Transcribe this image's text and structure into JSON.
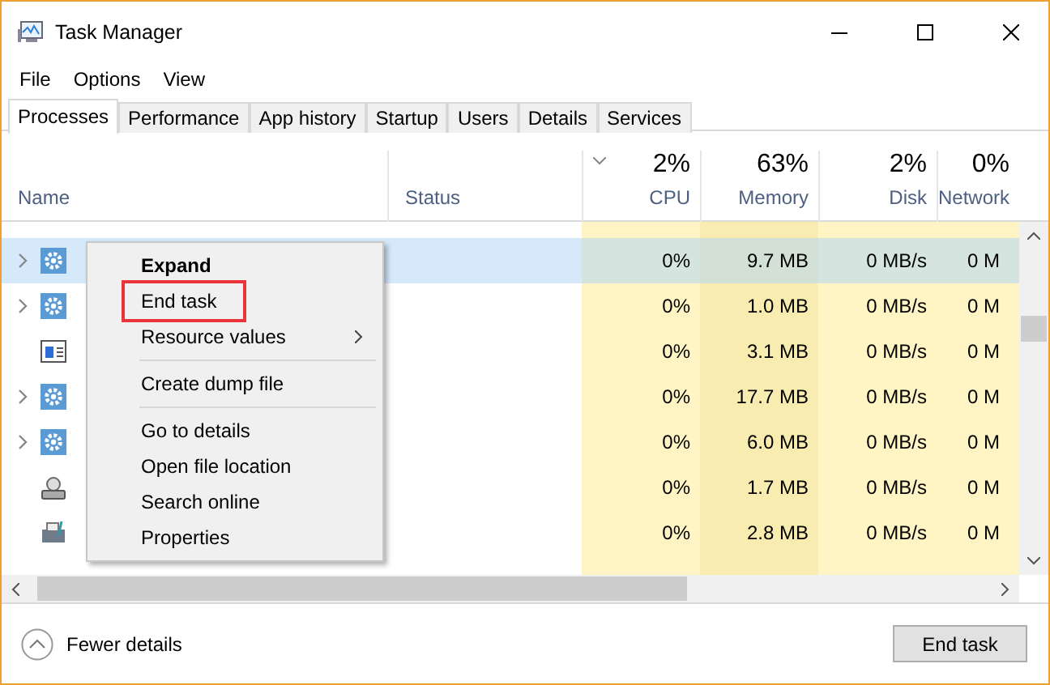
{
  "window": {
    "title": "Task Manager"
  },
  "menu": [
    "File",
    "Options",
    "View"
  ],
  "tabs": [
    {
      "label": "Processes",
      "selected": true
    },
    {
      "label": "Performance",
      "selected": false
    },
    {
      "label": "App history",
      "selected": false
    },
    {
      "label": "Startup",
      "selected": false
    },
    {
      "label": "Users",
      "selected": false
    },
    {
      "label": "Details",
      "selected": false
    },
    {
      "label": "Services",
      "selected": false
    }
  ],
  "table": {
    "columns": [
      {
        "label": "Name"
      },
      {
        "label": "Status"
      },
      {
        "label": "CPU",
        "usage": "2%"
      },
      {
        "label": "Memory",
        "usage": "63%"
      },
      {
        "label": "Disk",
        "usage": "2%"
      },
      {
        "label": "Network",
        "usage": "0%"
      }
    ],
    "rows": [
      {
        "kind": "service",
        "selected": true,
        "cpu": "0%",
        "memory": "9.7 MB",
        "disk": "0 MB/s",
        "network": "0 M"
      },
      {
        "kind": "service",
        "selected": false,
        "cpu": "0%",
        "memory": "1.0 MB",
        "disk": "0 MB/s",
        "network": "0 M"
      },
      {
        "kind": "window",
        "selected": false,
        "cpu": "0%",
        "memory": "3.1 MB",
        "disk": "0 MB/s",
        "network": "0 M"
      },
      {
        "kind": "service",
        "selected": false,
        "cpu": "0%",
        "memory": "17.7 MB",
        "disk": "0 MB/s",
        "network": "0 M"
      },
      {
        "kind": "service",
        "selected": false,
        "cpu": "0%",
        "memory": "6.0 MB",
        "disk": "0 MB/s",
        "network": "0 M"
      },
      {
        "kind": "user",
        "selected": false,
        "cpu": "0%",
        "memory": "1.7 MB",
        "disk": "0 MB/s",
        "network": "0 M"
      },
      {
        "kind": "printer",
        "selected": false,
        "cpu": "0%",
        "memory": "2.8 MB",
        "disk": "0 MB/s",
        "network": "0 M"
      }
    ]
  },
  "context_menu": [
    {
      "kind": "item",
      "label": "Expand",
      "bold": true,
      "submenu": false,
      "highlighted": false
    },
    {
      "kind": "item",
      "label": "End task",
      "bold": false,
      "submenu": false,
      "highlighted": true
    },
    {
      "kind": "item",
      "label": "Resource values",
      "bold": false,
      "submenu": true,
      "highlighted": false
    },
    {
      "kind": "separator"
    },
    {
      "kind": "item",
      "label": "Create dump file",
      "bold": false,
      "submenu": false,
      "highlighted": false
    },
    {
      "kind": "separator"
    },
    {
      "kind": "item",
      "label": "Go to details",
      "bold": false,
      "submenu": false,
      "highlighted": false
    },
    {
      "kind": "item",
      "label": "Open file location",
      "bold": false,
      "submenu": false,
      "highlighted": false
    },
    {
      "kind": "item",
      "label": "Search online",
      "bold": false,
      "submenu": false,
      "highlighted": false
    },
    {
      "kind": "item",
      "label": "Properties",
      "bold": false,
      "submenu": false,
      "highlighted": false
    }
  ],
  "footer": {
    "toggle": "Fewer details",
    "button": "End task"
  }
}
